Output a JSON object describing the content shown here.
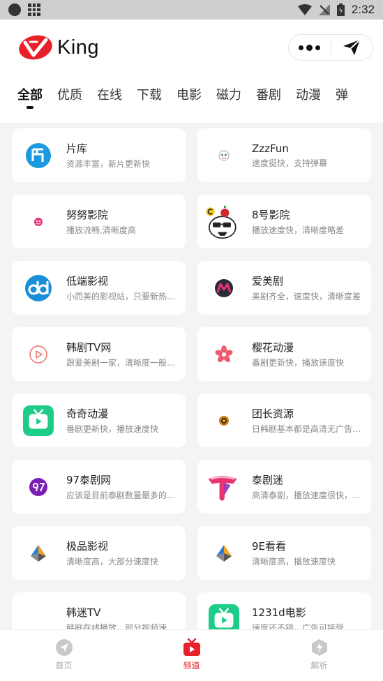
{
  "status_bar": {
    "time": "2:32"
  },
  "header": {
    "logo_text": "King",
    "brand_color": "#e8202a"
  },
  "tabs": [
    {
      "label": "全部",
      "active": true
    },
    {
      "label": "优质"
    },
    {
      "label": "在线"
    },
    {
      "label": "下载"
    },
    {
      "label": "电影"
    },
    {
      "label": "磁力"
    },
    {
      "label": "番剧"
    },
    {
      "label": "动漫"
    },
    {
      "label": "弹"
    }
  ],
  "sites": [
    {
      "title": "片库",
      "desc": "资源丰富，新片更新快",
      "icon": "pianku-icon"
    },
    {
      "title": "ZzzFun",
      "desc": "速度挺快，支持弹幕",
      "icon": "zzzfun-icon"
    },
    {
      "title": "努努影院",
      "desc": "播放流畅,清晰度高",
      "icon": "nunu-icon"
    },
    {
      "title": "8号影院",
      "desc": "播放速度快，清晰度略差",
      "icon": "8hao-icon"
    },
    {
      "title": "低端影视",
      "desc": "小而美的影视站，只要新热…",
      "icon": "ddys-icon"
    },
    {
      "title": "爱美剧",
      "desc": "美剧齐全，速度快，清晰度差",
      "icon": "aimeiju-icon"
    },
    {
      "title": "韩剧TV网",
      "desc": "跟爱美剧一家，清晰度一般…",
      "icon": "hanjutv-icon"
    },
    {
      "title": "樱花动漫",
      "desc": "番剧更新快，播放速度快",
      "icon": "sakura-icon"
    },
    {
      "title": "奇奇动漫",
      "desc": "番剧更新快，播放速度快",
      "icon": "qiqi-icon"
    },
    {
      "title": "团长资源",
      "desc": "日韩剧基本都是高清无广告…",
      "icon": "tuanzhang-icon"
    },
    {
      "title": "97泰剧网",
      "desc": "应该是目前泰剧数量最多的…",
      "icon": "97taiju-icon"
    },
    {
      "title": "泰剧迷",
      "desc": "高清泰剧，播放速度很快，…",
      "icon": "taijumi-icon"
    },
    {
      "title": "极品影视",
      "desc": "清晰度高，大部分速度快",
      "icon": "jipin-icon"
    },
    {
      "title": "9E看看",
      "desc": "清晰度高，播放速度快",
      "icon": "9ekankan-icon"
    },
    {
      "title": "韩迷TV",
      "desc": "韩剧在线播放，部分视频速…",
      "icon": "hanmitv-icon"
    },
    {
      "title": "1231d电影",
      "desc": "速度还不错，广告可接受",
      "icon": "1231d-icon"
    }
  ],
  "bottom_nav": [
    {
      "label": "首页",
      "icon": "compass-icon"
    },
    {
      "label": "频道",
      "icon": "tv-icon",
      "active": true
    },
    {
      "label": "解析",
      "icon": "lightning-icon"
    }
  ]
}
